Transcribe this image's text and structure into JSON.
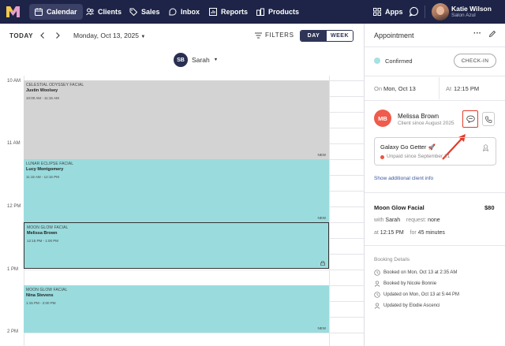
{
  "nav": {
    "items": [
      {
        "label": "Calendar",
        "icon": "calendar-icon",
        "active": true
      },
      {
        "label": "Clients",
        "icon": "clients-icon",
        "active": false
      },
      {
        "label": "Sales",
        "icon": "tag-icon",
        "active": false
      },
      {
        "label": "Inbox",
        "icon": "inbox-icon",
        "active": false
      },
      {
        "label": "Reports",
        "icon": "bar-chart-icon",
        "active": false
      },
      {
        "label": "Products",
        "icon": "products-icon",
        "active": false
      }
    ],
    "apps_label": "Apps",
    "user": {
      "name": "Katie Wilson",
      "salon": "Salon Azul"
    }
  },
  "toolbar": {
    "today": "TODAY",
    "date": "Monday, Oct 13, 2025",
    "filters": "FILTERS",
    "day": "DAY",
    "week": "WEEK"
  },
  "staff": {
    "initials": "SB",
    "name": "Sarah"
  },
  "hours": [
    "10 AM",
    "11 AM",
    "12 PM",
    "1 PM",
    "2 PM"
  ],
  "appointments": [
    {
      "service": "CELESTIAL ODYSSEY FACIAL",
      "client": "Justin Woolsey",
      "time": "10:00 AM - 11:15 AM",
      "badge": "NEW",
      "color": "#d3d3d3"
    },
    {
      "service": "LUNAR ECLIPSE FACIAL",
      "client": "Lucy Montgomery",
      "time": "11:15 AM - 12:15 PM",
      "badge": "NEW",
      "color": "#9adcde"
    },
    {
      "service": "MOON GLOW FACIAL",
      "client": "Melissa Brown",
      "time": "12:15 PM - 1:00 PM",
      "badge": "",
      "color": "#9adcde",
      "selected": true
    },
    {
      "service": "MOON GLOW FACIAL",
      "client": "Nina Stevens",
      "time": "1:15 PM - 2:00 PM",
      "badge": "NEW",
      "color": "#9adcde"
    }
  ],
  "panel": {
    "title": "Appointment",
    "status": "Confirmed",
    "checkin": "CHECK-IN",
    "on_label": "On",
    "on_value": "Mon, Oct 13",
    "at_label": "At",
    "at_value": "12:15 PM",
    "client": {
      "initials": "MB",
      "name": "Melissa Brown",
      "since": "Client since August 2025"
    },
    "membership": {
      "title": "Galaxy Go Getter 🚀",
      "status": "Unpaid since September 21"
    },
    "show_info": "Show additional client info",
    "service": {
      "name": "Moon Glow Facial",
      "price": "$80",
      "with_label": "with",
      "with_value": "Sarah",
      "request_label": "request:",
      "request_value": "none",
      "at_label": "at",
      "at_value": "12:15 PM",
      "for_label": "for",
      "for_value": "45 minutes"
    },
    "booking": {
      "title": "Booking Details",
      "rows": [
        "Booked on Mon, Oct 13 at 2:35 AM",
        "Booked by Nicole Bonnie",
        "Updated on Mon, Oct 13 at 5:44 PM",
        "Updated by Elodie Ascenci"
      ]
    }
  },
  "colors": {
    "nav_bg": "#1e2447",
    "teal": "#9adcde",
    "gray": "#d3d3d3",
    "accent_red": "#e53a2a",
    "client_avatar": "#ef5b4c"
  }
}
